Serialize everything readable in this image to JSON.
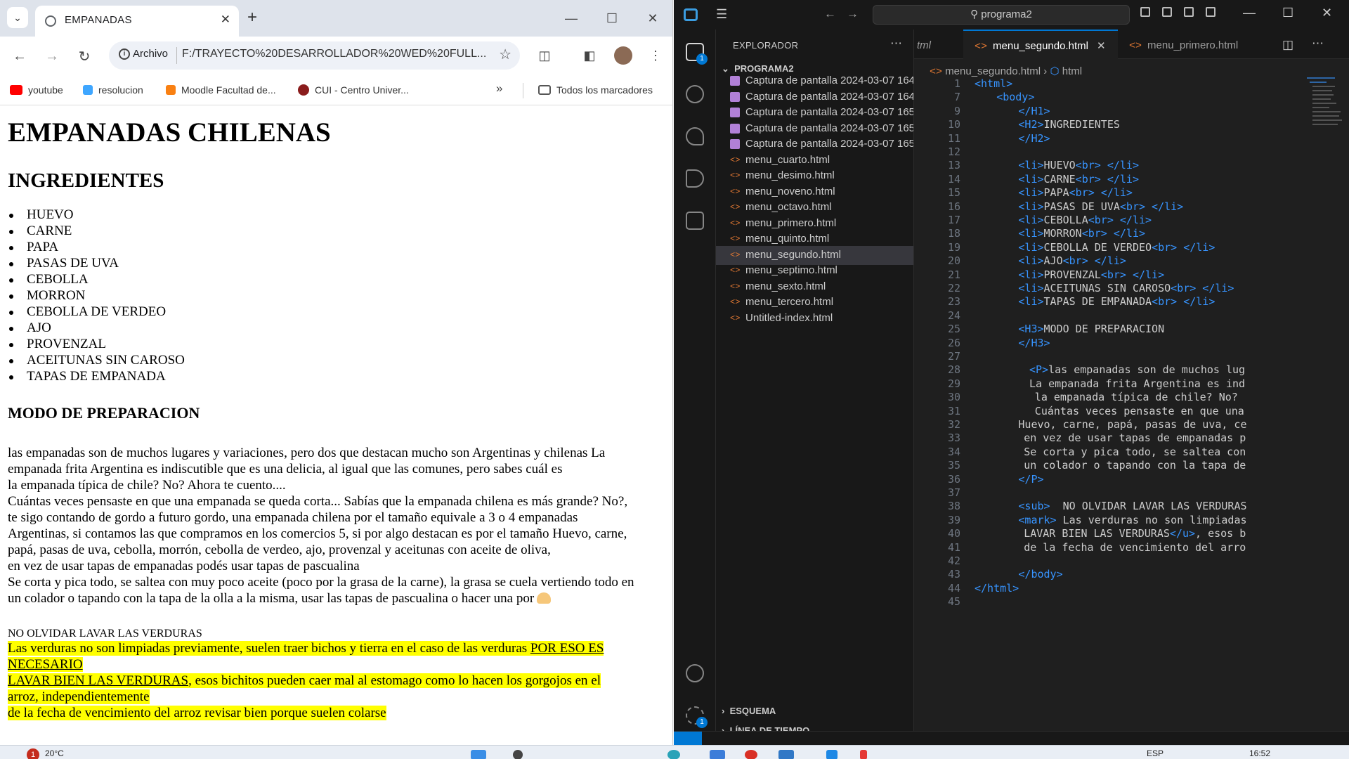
{
  "chrome": {
    "tab_title": "EMPANADAS",
    "origin_label": "Archivo",
    "url": "F:/TRAYECTO%20DESARROLLADOR%20WED%20FULL...",
    "bookmarks": [
      "youtube",
      "resolucion",
      "Moodle Facultad de...",
      "CUI - Centro Univer..."
    ],
    "all_bookmarks": "Todos los marcadores"
  },
  "page": {
    "h1": "EMPANADAS CHILENAS",
    "h2": "INGREDIENTES",
    "ingredients": [
      "HUEVO",
      "CARNE",
      "PAPA",
      "PASAS DE UVA",
      "CEBOLLA",
      "MORRON",
      "CEBOLLA DE VERDEO",
      "AJO",
      "PROVENZAL",
      "ACEITUNAS SIN CAROSO",
      "TAPAS DE EMPANADA"
    ],
    "h3": "MODO DE PREPARACION",
    "paragraph_lines": [
      "las empanadas son de muchos lugares y variaciones, pero dos que destacan mucho son Argentinas y chilenas La",
      "empanada frita Argentina es indiscutible que es una delicia, al igual que las comunes, pero sabes cuál es",
      "la empanada típica de chile? No? Ahora te cuento....",
      "Cuántas veces pensaste en que una empanada se queda corta... Sabías que la empanada chilena es más grande? No?,",
      "te sigo contando de gordo a futuro gordo, una empanada chilena por el tamaño equivale a 3 o 4 empanadas",
      "Argentinas, si contamos las que compramos en los comercios 5, si por algo destacan es por el tamaño Huevo, carne,",
      "papá, pasas de uva, cebolla, morrón, cebolla de verdeo, ajo, provenzal y aceitunas con aceite de oliva,",
      "en vez de usar tapas de empanadas podés usar tapas de pascualina",
      "Se corta y pica todo, se saltea con muy poco aceite (poco por la grasa de la carne), la grasa se cuela vertiendo todo en",
      "un colador o tapando con la tapa de la olla a la misma, usar las tapas de pascualina o hacer una por"
    ],
    "sub_text": "NO OLVIDAR LAVAR LAS VERDURAS",
    "mark_line1": "Las verduras no son limpiadas previamente, suelen traer bichos y tierra en el caso de las verduras ",
    "mark_line1_u": "POR ESO ES",
    "mark_line2_u": "NECESARIO",
    "mark_line3_u": "LAVAR BIEN LAS VERDURAS",
    "mark_line3": ", esos bichitos pueden caer mal al estomago como lo hacen los gorgojos en el",
    "mark_line4": "arroz, independientemente",
    "mark_line5": "de la fecha de vencimiento del arroz revisar bien porque suelen colarse"
  },
  "vscode": {
    "search": "programa2",
    "explorer_title": "EXPLORADOR",
    "folder": "PROGRAMA2",
    "files": [
      {
        "name": "Captura de pantalla 2024-03-07 164...",
        "kind": "img"
      },
      {
        "name": "Captura de pantalla 2024-03-07 164...",
        "kind": "img"
      },
      {
        "name": "Captura de pantalla 2024-03-07 165...",
        "kind": "img"
      },
      {
        "name": "Captura de pantalla 2024-03-07 165...",
        "kind": "img"
      },
      {
        "name": "Captura de pantalla 2024-03-07 165...",
        "kind": "img"
      },
      {
        "name": "menu_cuarto.html",
        "kind": "html"
      },
      {
        "name": "menu_desimo.html",
        "kind": "html"
      },
      {
        "name": "menu_noveno.html",
        "kind": "html"
      },
      {
        "name": "menu_octavo.html",
        "kind": "html"
      },
      {
        "name": "menu_primero.html",
        "kind": "html"
      },
      {
        "name": "menu_quinto.html",
        "kind": "html"
      },
      {
        "name": "menu_segundo.html",
        "kind": "html",
        "active": true
      },
      {
        "name": "menu_septimo.html",
        "kind": "html"
      },
      {
        "name": "menu_sexto.html",
        "kind": "html"
      },
      {
        "name": "menu_tercero.html",
        "kind": "html"
      },
      {
        "name": "Untitled-index.html",
        "kind": "html"
      }
    ],
    "outline": "ESQUEMA",
    "timeline": "LÍNEA DE TIEMPO",
    "tabs": [
      "tml",
      "menu_segundo.html",
      "menu_primero.html"
    ],
    "breadcrumb_file": "menu_segundo.html",
    "breadcrumb_node": "html",
    "code": [
      {
        "n": "1",
        "i": 0,
        "t": [
          [
            "tag",
            "<html>"
          ]
        ]
      },
      {
        "n": "7",
        "i": 4,
        "t": [
          [
            "tag",
            "<body>"
          ]
        ]
      },
      {
        "n": "9",
        "i": 8,
        "t": [
          [
            "tag",
            "</H1>"
          ]
        ]
      },
      {
        "n": "10",
        "i": 8,
        "t": [
          [
            "tag",
            "<H2>"
          ],
          [
            "txt",
            "INGREDIENTES"
          ]
        ]
      },
      {
        "n": "11",
        "i": 8,
        "t": [
          [
            "tag",
            "</H2>"
          ]
        ]
      },
      {
        "n": "12",
        "i": 0,
        "t": []
      },
      {
        "n": "13",
        "i": 8,
        "t": [
          [
            "tag",
            "<li>"
          ],
          [
            "txt",
            "HUEVO"
          ],
          [
            "tag",
            "<br>"
          ],
          [
            "txt",
            " "
          ],
          [
            "tag",
            "</li>"
          ]
        ]
      },
      {
        "n": "14",
        "i": 8,
        "t": [
          [
            "tag",
            "<li>"
          ],
          [
            "txt",
            "CARNE"
          ],
          [
            "tag",
            "<br>"
          ],
          [
            "txt",
            " "
          ],
          [
            "tag",
            "</li>"
          ]
        ]
      },
      {
        "n": "15",
        "i": 8,
        "t": [
          [
            "tag",
            "<li>"
          ],
          [
            "txt",
            "PAPA"
          ],
          [
            "tag",
            "<br>"
          ],
          [
            "txt",
            " "
          ],
          [
            "tag",
            "</li>"
          ]
        ]
      },
      {
        "n": "16",
        "i": 8,
        "t": [
          [
            "tag",
            "<li>"
          ],
          [
            "txt",
            "PASAS DE UVA"
          ],
          [
            "tag",
            "<br>"
          ],
          [
            "txt",
            " "
          ],
          [
            "tag",
            "</li>"
          ]
        ]
      },
      {
        "n": "17",
        "i": 8,
        "t": [
          [
            "tag",
            "<li>"
          ],
          [
            "txt",
            "CEBOLLA"
          ],
          [
            "tag",
            "<br>"
          ],
          [
            "txt",
            " "
          ],
          [
            "tag",
            "</li>"
          ]
        ]
      },
      {
        "n": "18",
        "i": 8,
        "t": [
          [
            "tag",
            "<li>"
          ],
          [
            "txt",
            "MORRON"
          ],
          [
            "tag",
            "<br>"
          ],
          [
            "txt",
            " "
          ],
          [
            "tag",
            "</li>"
          ]
        ]
      },
      {
        "n": "19",
        "i": 8,
        "t": [
          [
            "tag",
            "<li>"
          ],
          [
            "txt",
            "CEBOLLA DE VERDEO"
          ],
          [
            "tag",
            "<br>"
          ],
          [
            "txt",
            " "
          ],
          [
            "tag",
            "</li>"
          ]
        ]
      },
      {
        "n": "20",
        "i": 8,
        "t": [
          [
            "tag",
            "<li>"
          ],
          [
            "txt",
            "AJO"
          ],
          [
            "tag",
            "<br>"
          ],
          [
            "txt",
            " "
          ],
          [
            "tag",
            "</li>"
          ]
        ]
      },
      {
        "n": "21",
        "i": 8,
        "t": [
          [
            "tag",
            "<li>"
          ],
          [
            "txt",
            "PROVENZAL"
          ],
          [
            "tag",
            "<br>"
          ],
          [
            "txt",
            " "
          ],
          [
            "tag",
            "</li>"
          ]
        ]
      },
      {
        "n": "22",
        "i": 8,
        "t": [
          [
            "tag",
            "<li>"
          ],
          [
            "txt",
            "ACEITUNAS SIN CAROSO"
          ],
          [
            "tag",
            "<br>"
          ],
          [
            "txt",
            " "
          ],
          [
            "tag",
            "</li>"
          ]
        ]
      },
      {
        "n": "23",
        "i": 8,
        "t": [
          [
            "tag",
            "<li>"
          ],
          [
            "txt",
            "TAPAS DE EMPANADA"
          ],
          [
            "tag",
            "<br>"
          ],
          [
            "txt",
            " "
          ],
          [
            "tag",
            "</li>"
          ]
        ]
      },
      {
        "n": "24",
        "i": 0,
        "t": []
      },
      {
        "n": "25",
        "i": 8,
        "t": [
          [
            "tag",
            "<H3>"
          ],
          [
            "txt",
            "MODO DE PREPARACION"
          ]
        ]
      },
      {
        "n": "26",
        "i": 8,
        "t": [
          [
            "tag",
            "</H3>"
          ]
        ]
      },
      {
        "n": "27",
        "i": 0,
        "t": []
      },
      {
        "n": "28",
        "i": 10,
        "t": [
          [
            "tag",
            "<P>"
          ],
          [
            "txt",
            "las empanadas son de muchos lug"
          ]
        ]
      },
      {
        "n": "29",
        "i": 10,
        "t": [
          [
            "txt",
            "La empanada frita Argentina es ind"
          ]
        ]
      },
      {
        "n": "30",
        "i": 11,
        "t": [
          [
            "txt",
            "la empanada típica de chile? No?"
          ]
        ]
      },
      {
        "n": "31",
        "i": 11,
        "t": [
          [
            "txt",
            "Cuántas veces pensaste en que una"
          ]
        ]
      },
      {
        "n": "32",
        "i": 8,
        "t": [
          [
            "txt",
            "Huevo, carne, papá, pasas de uva, ce"
          ]
        ]
      },
      {
        "n": "33",
        "i": 9,
        "t": [
          [
            "txt",
            "en vez de usar tapas de empanadas p"
          ]
        ]
      },
      {
        "n": "34",
        "i": 9,
        "t": [
          [
            "txt",
            "Se corta y pica todo, se saltea con"
          ]
        ]
      },
      {
        "n": "35",
        "i": 9,
        "t": [
          [
            "txt",
            "un colador o tapando con la tapa de"
          ]
        ]
      },
      {
        "n": "36",
        "i": 8,
        "t": [
          [
            "tag",
            "</P>"
          ]
        ]
      },
      {
        "n": "37",
        "i": 0,
        "t": []
      },
      {
        "n": "38",
        "i": 8,
        "t": [
          [
            "tag",
            "<sub>"
          ],
          [
            "txt",
            "  NO OLVIDAR LAVAR LAS VERDURAS"
          ]
        ]
      },
      {
        "n": "39",
        "i": 8,
        "t": [
          [
            "tag",
            "<mark>"
          ],
          [
            "txt",
            " Las verduras no son limpiadas"
          ]
        ]
      },
      {
        "n": "40",
        "i": 9,
        "t": [
          [
            "txt",
            "LAVAR BIEN LAS VERDURAS"
          ],
          [
            "tag",
            "</u>"
          ],
          [
            "txt",
            ", esos b"
          ]
        ]
      },
      {
        "n": "41",
        "i": 9,
        "t": [
          [
            "txt",
            "de la fecha de vencimiento del arro"
          ]
        ]
      },
      {
        "n": "42",
        "i": 0,
        "t": []
      },
      {
        "n": "43",
        "i": 8,
        "t": [
          [
            "tag",
            "</body>"
          ]
        ]
      },
      {
        "n": "44",
        "i": 0,
        "t": [
          [
            "tag",
            "</html>"
          ]
        ]
      },
      {
        "n": "45",
        "i": 0,
        "t": []
      }
    ]
  },
  "taskbar": {
    "weather_badge": "1",
    "weather": "20°C",
    "lang": "ESP",
    "time": "16:52"
  }
}
